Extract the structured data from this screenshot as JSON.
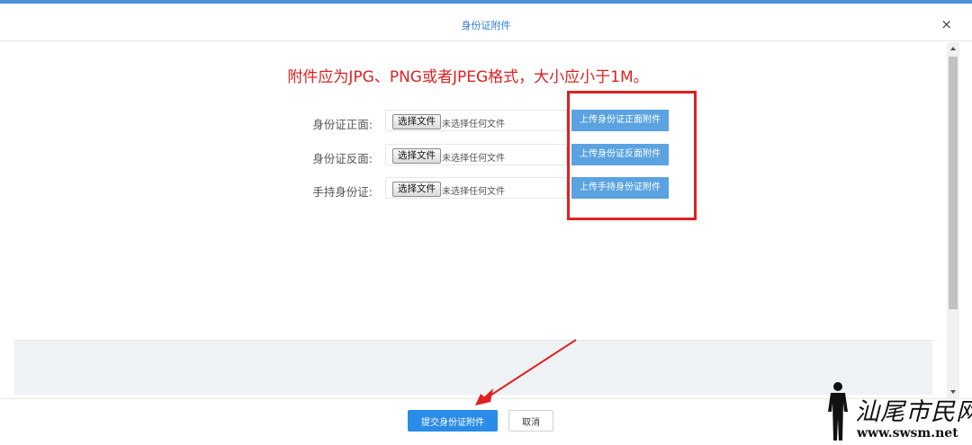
{
  "dialog": {
    "title": "身份证附件",
    "close_symbol": "×"
  },
  "notice": "附件应为JPG、PNG或者JPEG格式，大小应小于1M。",
  "rows": [
    {
      "label": "身份证正面:",
      "choose_label": "选择文件",
      "file_status": "未选择任何文件",
      "upload_label": "上传身份证正面附件"
    },
    {
      "label": "身份证反面:",
      "choose_label": "选择文件",
      "file_status": "未选择任何文件",
      "upload_label": "上传身份证反面附件"
    },
    {
      "label": "手持身份证:",
      "choose_label": "选择文件",
      "file_status": "未选择任何文件",
      "upload_label": "上传手持身份证附件"
    }
  ],
  "footer": {
    "submit_label": "提交身份证附件",
    "cancel_label": "取消"
  },
  "watermark": {
    "text": "汕尾市民网",
    "url": "www.swsm.net"
  },
  "colors": {
    "accent": "#2b8ce8",
    "upload_button": "#5aa3e0",
    "notice_red": "#e02020",
    "title_blue": "#2e7bcf"
  }
}
